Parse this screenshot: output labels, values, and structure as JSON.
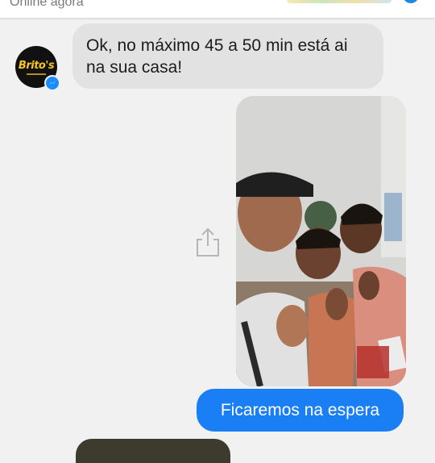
{
  "header": {
    "status": "Online agora"
  },
  "contact": {
    "avatar_logo_text": "Brito's"
  },
  "messages": [
    {
      "direction": "incoming",
      "text": "Ok, no máximo 45 a 50 min está ai na sua casa!"
    },
    {
      "direction": "outgoing",
      "type": "photo",
      "description_icon": "photo-attachment"
    },
    {
      "direction": "outgoing",
      "text": "Ficaremos na espera"
    }
  ],
  "colors": {
    "incoming_bubble": "#e2e2e2",
    "outgoing_bubble": "#1a7ef5",
    "background": "#f1f1f1",
    "badge": "#1a8cff",
    "logo": "#f7c325"
  },
  "icons": {
    "share": "share-icon",
    "messenger_badge": "messenger-badge-icon"
  }
}
